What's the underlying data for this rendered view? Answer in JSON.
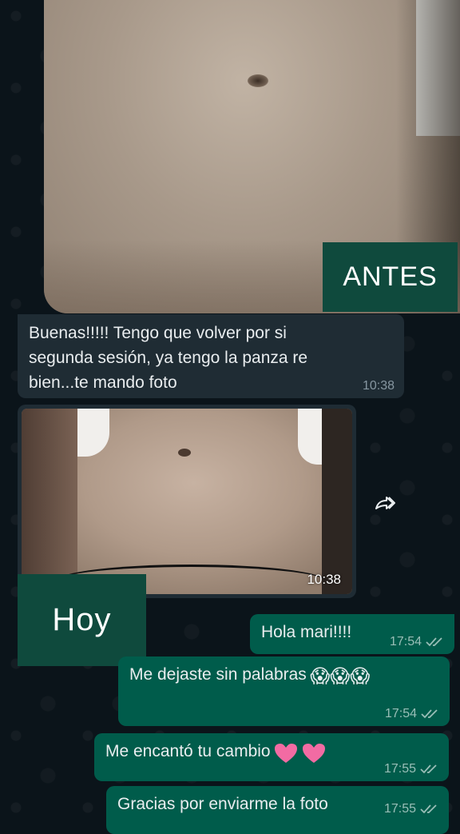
{
  "labels": {
    "before": "ANTES",
    "today": "Hoy"
  },
  "messages": {
    "incoming_text": {
      "text": "Buenas!!!!! Tengo que volver por si\nsegunda sesión,  ya tengo la panza re\nbien...te mando foto",
      "time": "10:38"
    },
    "incoming_photo": {
      "time": "10:38"
    },
    "outgoing": [
      {
        "text": "Hola mari!!!!",
        "time": "17:54",
        "emoji": ""
      },
      {
        "text": "Me dejaste sin palabras",
        "time": "17:54",
        "emoji": "😱😱😱"
      },
      {
        "text": "Me encantó tu cambio",
        "time": "17:55",
        "emoji": "heart-heart"
      },
      {
        "text": "Gracias por enviarme la foto",
        "time": "17:55",
        "emoji": ""
      }
    ]
  },
  "colors": {
    "background": "#0b141a",
    "incoming_bubble": "#1f2c34",
    "outgoing_bubble": "#005c4b",
    "label_box": "#0f4a3d",
    "timestamp": "#8696a0"
  },
  "icons": {
    "forward": "forward-icon",
    "read_receipt": "double-check-icon",
    "heart": "pink-heart-icon"
  }
}
